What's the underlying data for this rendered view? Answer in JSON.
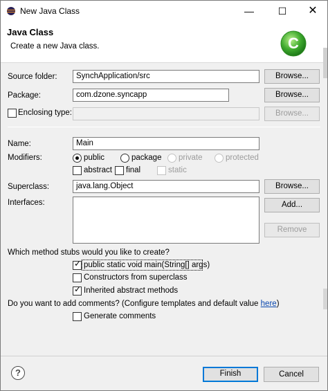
{
  "window": {
    "title": "New Java Class"
  },
  "banner": {
    "title": "Java Class",
    "description": "Create a new Java class.",
    "logo_letter": "C"
  },
  "source_folder": {
    "label": "Source folder:",
    "value": "SynchApplication/src",
    "browse_label": "Browse..."
  },
  "package": {
    "label": "Package:",
    "value": "com.dzone.syncapp",
    "browse_label": "Browse..."
  },
  "enclosing_type": {
    "label": "Enclosing type:",
    "checked": false,
    "value": "",
    "browse_label": "Browse..."
  },
  "name": {
    "label": "Name:",
    "value": "Main"
  },
  "modifiers": {
    "label": "Modifiers:",
    "options": [
      "public",
      "package",
      "private",
      "protected"
    ],
    "selected": "public",
    "extra": [
      "abstract",
      "final",
      "static"
    ]
  },
  "superclass": {
    "label": "Superclass:",
    "value": "java.lang.Object",
    "browse_label": "Browse..."
  },
  "interfaces": {
    "label": "Interfaces:",
    "add_label": "Add...",
    "remove_label": "Remove"
  },
  "stubs": {
    "question": "Which method stubs would you like to create?",
    "items": [
      {
        "label": "public static void main(String[] args)",
        "checked": true
      },
      {
        "label": "Constructors from superclass",
        "checked": false
      },
      {
        "label": "Inherited abstract methods",
        "checked": true
      }
    ]
  },
  "comments": {
    "question": "Do you want to add comments? (Configure templates and default value ",
    "link": "here",
    "question_end": ")",
    "generate_label": "Generate comments",
    "checked": false
  },
  "footer": {
    "help": "?",
    "finish_label": "Finish",
    "cancel_label": "Cancel"
  },
  "colors": {
    "accent": "#0078d7",
    "link": "#0645ad",
    "logo_green": "#3faa2e"
  }
}
